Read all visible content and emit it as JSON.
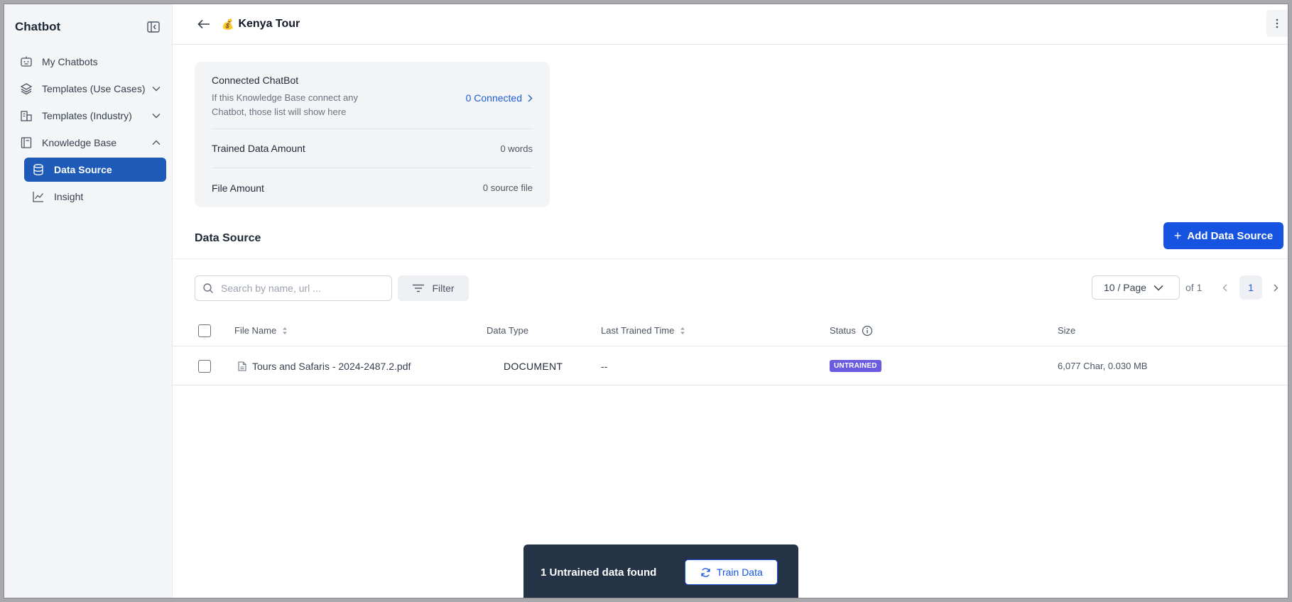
{
  "sidebar": {
    "title": "Chatbot",
    "items": [
      {
        "label": "My Chatbots",
        "icon": "robot-icon"
      },
      {
        "label": "Templates (Use Cases)",
        "icon": "layers-icon"
      },
      {
        "label": "Templates (Industry)",
        "icon": "building-icon"
      },
      {
        "label": "Knowledge Base",
        "icon": "book-icon"
      }
    ],
    "sub_items": [
      {
        "label": "Data Source",
        "icon": "database-icon",
        "active": true
      },
      {
        "label": "Insight",
        "icon": "line-chart-icon",
        "active": false
      }
    ]
  },
  "header": {
    "emoji": "💰",
    "title": "Kenya Tour"
  },
  "summary": {
    "connected_label": "Connected ChatBot",
    "connected_desc": "If this Knowledge Base connect any Chatbot, those list will show here",
    "connected_value": "0 Connected",
    "trained_label": "Trained Data Amount",
    "trained_value": "0 words",
    "file_label": "File Amount",
    "file_value": "0 source file"
  },
  "section": {
    "title": "Data Source",
    "add_button": "Add Data Source"
  },
  "toolbar": {
    "search_placeholder": "Search by name, url ...",
    "filter_label": "Filter",
    "page_size": "10 / Page",
    "of_pages": "of 1",
    "current_page": "1"
  },
  "table": {
    "columns": [
      "File Name",
      "Data Type",
      "Last Trained Time",
      "Status",
      "Size"
    ],
    "rows": [
      {
        "file_name": "Tours and Safaris - 2024-2487.2.pdf",
        "data_type": "DOCUMENT",
        "last_trained": "--",
        "status": "UNTRAINED",
        "size": "6,077 Char, 0.030 MB"
      }
    ]
  },
  "toast": {
    "message": "1 Untrained data found",
    "button": "Train Data"
  },
  "colors": {
    "accent": "#1553e0",
    "active_nav": "#1e5bb8",
    "badge_untrained": "#6a5be0",
    "toast_bg": "#253346"
  }
}
